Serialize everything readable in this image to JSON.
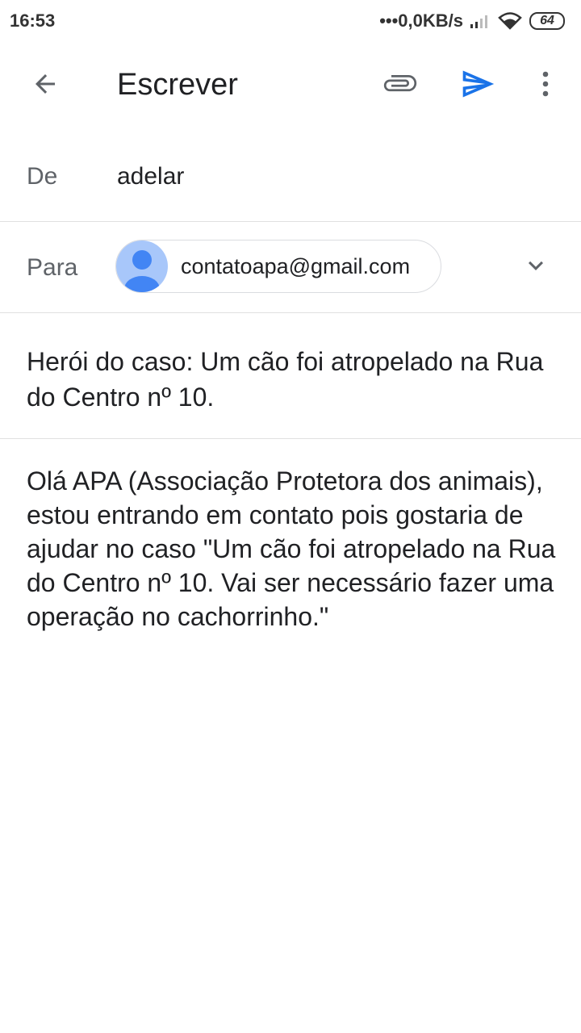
{
  "status_bar": {
    "time": "16:53",
    "network_speed": "•••0,0KB/s",
    "battery": "64"
  },
  "app_bar": {
    "back_icon": "arrow-back-icon",
    "title": "Escrever",
    "attach_icon": "paperclip-icon",
    "send_icon": "send-icon",
    "more_icon": "more-vert-icon"
  },
  "colors": {
    "accent": "#1a73e8",
    "avatar_bg": "#a8c7fa",
    "avatar_fg": "#4285f4"
  },
  "compose": {
    "from_label": "De",
    "from_value": "adelar",
    "to_label": "Para",
    "to_chip": "contatoapa@gmail.com",
    "subject": "Herói do caso: Um cão foi atropelado na Rua do Centro nº 10.",
    "body": "Olá APA (Associação Protetora dos animais), estou entrando em contato pois gostaria de ajudar no caso \"Um cão foi atropelado na Rua do Centro nº 10. Vai ser necessário fazer uma operação no cachorrinho.\""
  }
}
